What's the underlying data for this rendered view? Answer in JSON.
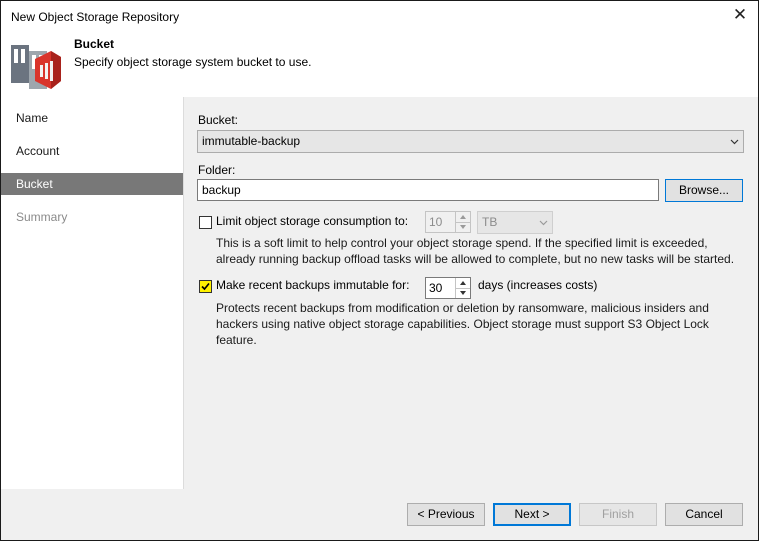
{
  "window": {
    "title": "New Object Storage Repository",
    "close_glyph": "✕"
  },
  "header": {
    "title": "Bucket",
    "subtitle": "Specify object storage system bucket to use.",
    "icon": "object-storage-bucket-icon"
  },
  "nav": {
    "items": [
      {
        "label": "Name",
        "state": "normal"
      },
      {
        "label": "Account",
        "state": "normal"
      },
      {
        "label": "Bucket",
        "state": "active"
      },
      {
        "label": "Summary",
        "state": "disabled"
      }
    ]
  },
  "bucket": {
    "label": "Bucket:",
    "value": "immutable-backup"
  },
  "folder": {
    "label": "Folder:",
    "value": "backup",
    "browse_label": "Browse..."
  },
  "limit": {
    "label": "Limit object storage consumption to:",
    "checked": false,
    "amount": "10",
    "unit": "TB",
    "description_line1": "This is a soft limit to help control your object storage spend. If the specified limit is exceeded,",
    "description_line2": "already running backup offload tasks will be allowed to complete, but no new tasks will be started."
  },
  "immutable": {
    "label": "Make recent backups immutable for:",
    "checked": true,
    "days": "30",
    "suffix": "days (increases costs)",
    "description_line1": "Protects recent backups from modification or deletion by ransomware, malicious insiders and",
    "description_line2": "hackers using native object storage capabilities. Object storage must support S3 Object Lock",
    "description_line3": "feature."
  },
  "footer": {
    "previous_label": "< Previous",
    "next_label": "Next >",
    "finish_label": "Finish",
    "cancel_label": "Cancel"
  },
  "colors": {
    "active_nav": "#787878",
    "checkbox_checked": "#fff200",
    "logo_red": "#d9342b",
    "logo_gray": "#6b7480"
  }
}
